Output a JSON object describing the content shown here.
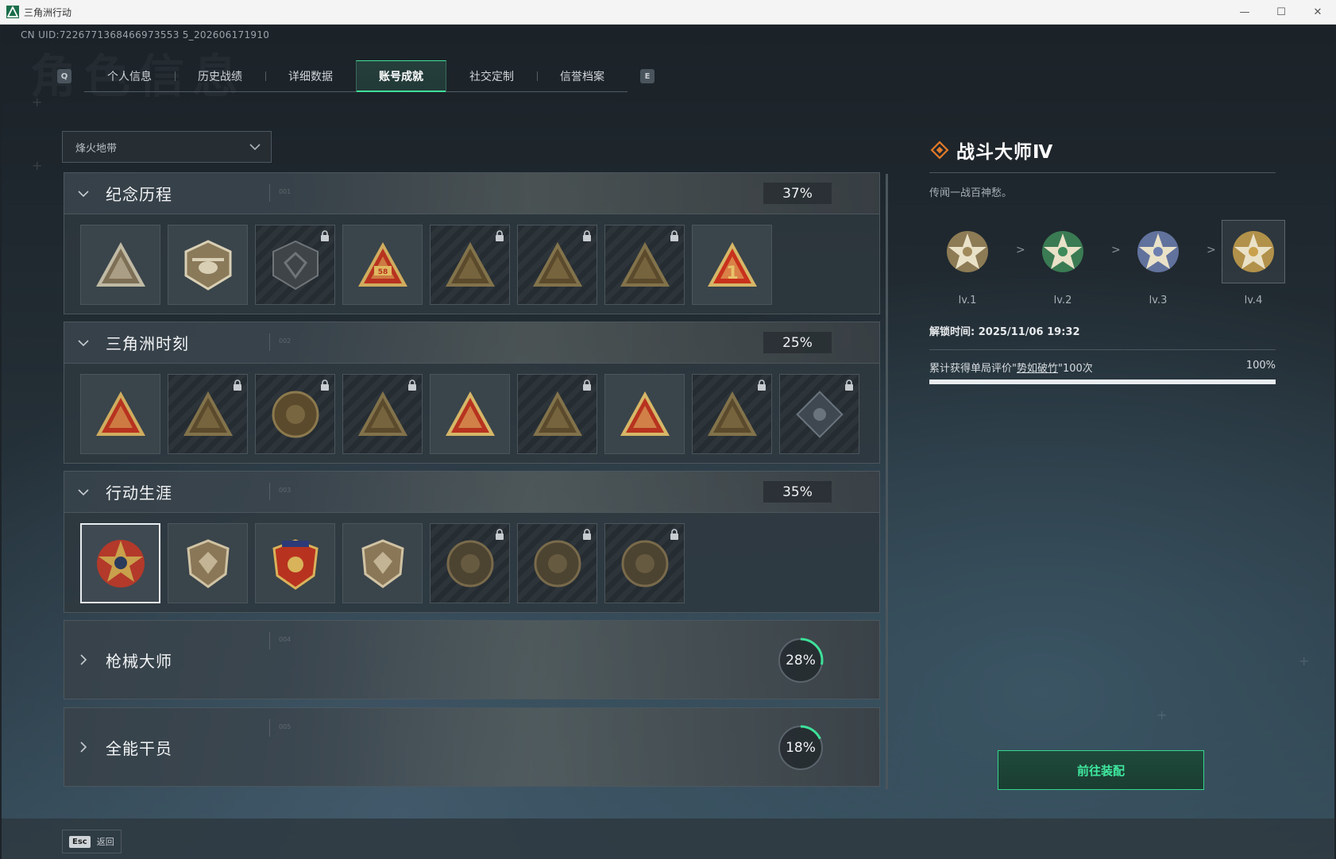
{
  "window": {
    "title": "三角洲行动"
  },
  "uid": "CN UID:7226771368466973553 5_202606171910",
  "watermark": "角色信息",
  "tabs": {
    "prev_key": "Q",
    "next_key": "E",
    "items": [
      {
        "label": "个人信息",
        "active": false
      },
      {
        "label": "历史战绩",
        "active": false
      },
      {
        "label": "详细数据",
        "active": false
      },
      {
        "label": "账号成就",
        "active": true
      },
      {
        "label": "社交定制",
        "active": false
      },
      {
        "label": "信誉档案",
        "active": false
      }
    ]
  },
  "mode_select": {
    "value": "烽火地带"
  },
  "categories": [
    {
      "name": "纪念历程",
      "idx": "001",
      "percent": "37%",
      "expanded": true,
      "badges": [
        {
          "icon": "triangle-mountain-emblem",
          "locked": false,
          "colors": [
            "#7c6f55",
            "#cfc7ae"
          ]
        },
        {
          "icon": "helicopter-emblem",
          "locked": false,
          "colors": [
            "#8b7a5a",
            "#d8cfb5"
          ]
        },
        {
          "icon": "shield-logo-emblem",
          "locked": true,
          "colors": [
            "#3f4448",
            "#6e7478"
          ]
        },
        {
          "icon": "sb-triangle-emblem",
          "locked": false,
          "colors": [
            "#b7321f",
            "#e0b860"
          ]
        },
        {
          "icon": "helicopter-triangle-emblem",
          "locked": true,
          "colors": [
            "#5b4a2c",
            "#8c7a4e"
          ]
        },
        {
          "icon": "soldier-triangle-emblem",
          "locked": true,
          "colors": [
            "#5b4a2c",
            "#8c7a4e"
          ]
        },
        {
          "icon": "skull-triangle-emblem",
          "locked": true,
          "colors": [
            "#5b4a2c",
            "#8c7a4e"
          ]
        },
        {
          "icon": "number-one-triangle-emblem",
          "locked": false,
          "colors": [
            "#c8321d",
            "#e8c36a"
          ]
        }
      ]
    },
    {
      "name": "三角洲时刻",
      "idx": "002",
      "percent": "25%",
      "expanded": true,
      "badges": [
        {
          "icon": "crate-triangle-emblem",
          "locked": false,
          "colors": [
            "#b7321f",
            "#e0b860"
          ]
        },
        {
          "icon": "robot-triangle-emblem",
          "locked": true,
          "colors": [
            "#5b4a2c",
            "#8c7a4e"
          ]
        },
        {
          "icon": "kneeling-soldier-emblem",
          "locked": true,
          "colors": [
            "#5b4a2c",
            "#8c7a4e"
          ]
        },
        {
          "icon": "dice-triangle-emblem",
          "locked": true,
          "colors": [
            "#5b4a2c",
            "#8c7a4e"
          ]
        },
        {
          "icon": "squad-triangle-emblem",
          "locked": false,
          "colors": [
            "#b7321f",
            "#e8c36a"
          ]
        },
        {
          "icon": "wolf-triangle-emblem",
          "locked": true,
          "colors": [
            "#5b4a2c",
            "#8c7a4e"
          ]
        },
        {
          "icon": "rocket-triangle-emblem",
          "locked": false,
          "colors": [
            "#b7321f",
            "#e8c36a"
          ]
        },
        {
          "icon": "dragon-triangle-emblem",
          "locked": true,
          "colors": [
            "#5b4a2c",
            "#8c7a4e"
          ]
        },
        {
          "icon": "diamond-emblem",
          "locked": true,
          "colors": [
            "#3f4850",
            "#6a747c"
          ]
        }
      ]
    },
    {
      "name": "行动生涯",
      "idx": "003",
      "percent": "35%",
      "expanded": true,
      "badges": [
        {
          "icon": "star-wreath-medal",
          "locked": false,
          "selected": true,
          "colors": [
            "#c9a14c",
            "#b33a2a"
          ]
        },
        {
          "icon": "chevron-shield-medal",
          "locked": false,
          "colors": [
            "#8a7757",
            "#cfc3a4"
          ]
        },
        {
          "icon": "eagle-crest-medal",
          "locked": false,
          "colors": [
            "#b7321f",
            "#d9b35a"
          ]
        },
        {
          "icon": "gem-shield-medal",
          "locked": false,
          "colors": [
            "#8a7757",
            "#cfc3a4"
          ]
        },
        {
          "icon": "planet-medal",
          "locked": true,
          "colors": [
            "#4c4330",
            "#786a4b"
          ]
        },
        {
          "icon": "skull-crosshair-medal",
          "locked": true,
          "colors": [
            "#4c4330",
            "#786a4b"
          ]
        },
        {
          "icon": "eye-medal",
          "locked": true,
          "colors": [
            "#4c4330",
            "#786a4b"
          ]
        }
      ]
    },
    {
      "name": "枪械大师",
      "idx": "004",
      "percent": "28%",
      "percent_value": 28,
      "expanded": false
    },
    {
      "name": "全能干员",
      "idx": "005",
      "percent": "18%",
      "percent_value": 18,
      "expanded": false
    }
  ],
  "detail": {
    "title": "战斗大师Ⅳ",
    "desc": "传闻一战百神愁。",
    "levels": [
      {
        "label": "lv.1",
        "color": "#a08a5c"
      },
      {
        "label": "lv.2",
        "color": "#3f8a5a"
      },
      {
        "label": "lv.3",
        "color": "#6d7fb0"
      },
      {
        "label": "lv.4",
        "color": "#c9a14c",
        "current": true
      }
    ],
    "arrow": ">",
    "unlock_time": "解锁时间: 2025/11/06 19:32",
    "condition_prefix": "累计获得单局评价\"",
    "condition_link": "势如破竹",
    "condition_suffix": "\"100次",
    "progress_label": "100%",
    "progress_value": 1.0
  },
  "equip_button": "前往装配",
  "footer": {
    "esc_key": "Esc",
    "esc_label": "返回"
  },
  "colors": {
    "accent": "#3fe09a",
    "detail_icon": "#e07a2a"
  }
}
